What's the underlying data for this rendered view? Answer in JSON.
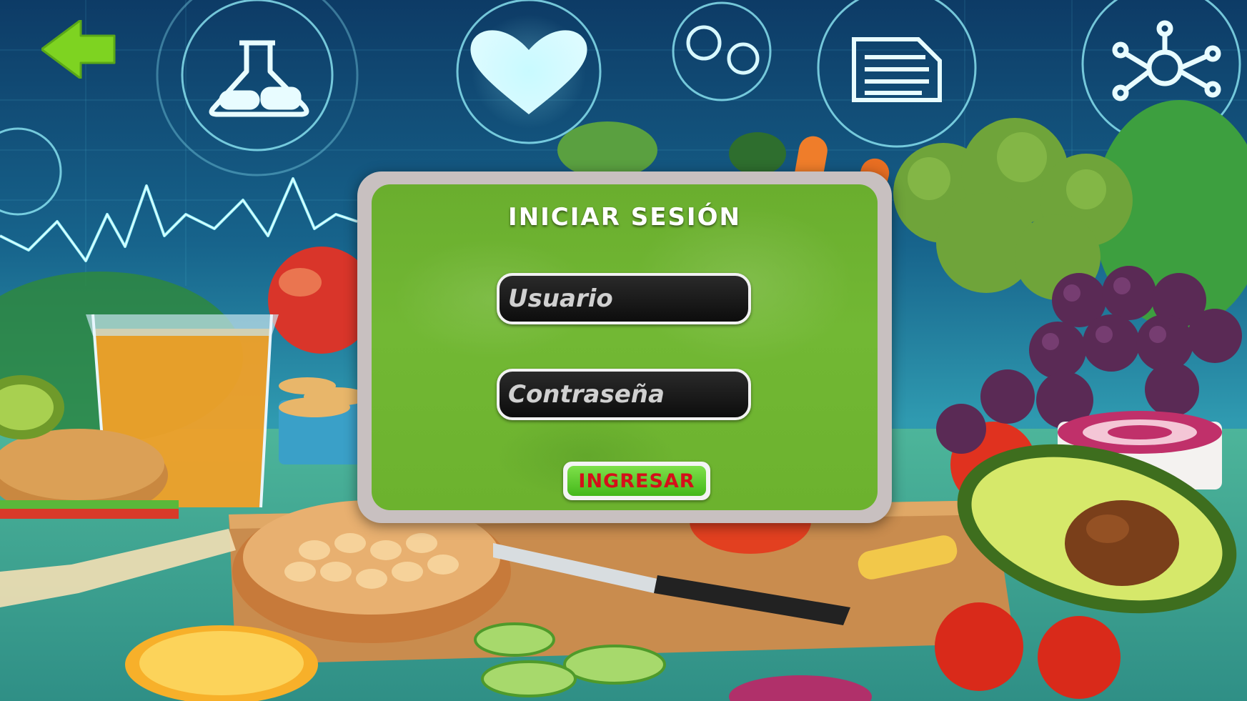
{
  "login": {
    "title": "INICIAR SESIÓN",
    "username_placeholder": "Usuario",
    "password_placeholder": "Contraseña",
    "submit_label": "INGRESAR"
  },
  "icons": {
    "back": "back-arrow-icon",
    "flask": "flask-icon",
    "heart": "heart-icon",
    "document": "document-icon",
    "molecule": "molecule-icon"
  },
  "colors": {
    "panel_green": "#6cb22e",
    "frame": "#c8c0c0",
    "submit_green": "#45b81a",
    "submit_text": "#d4101a",
    "back_arrow": "#7ed321"
  }
}
